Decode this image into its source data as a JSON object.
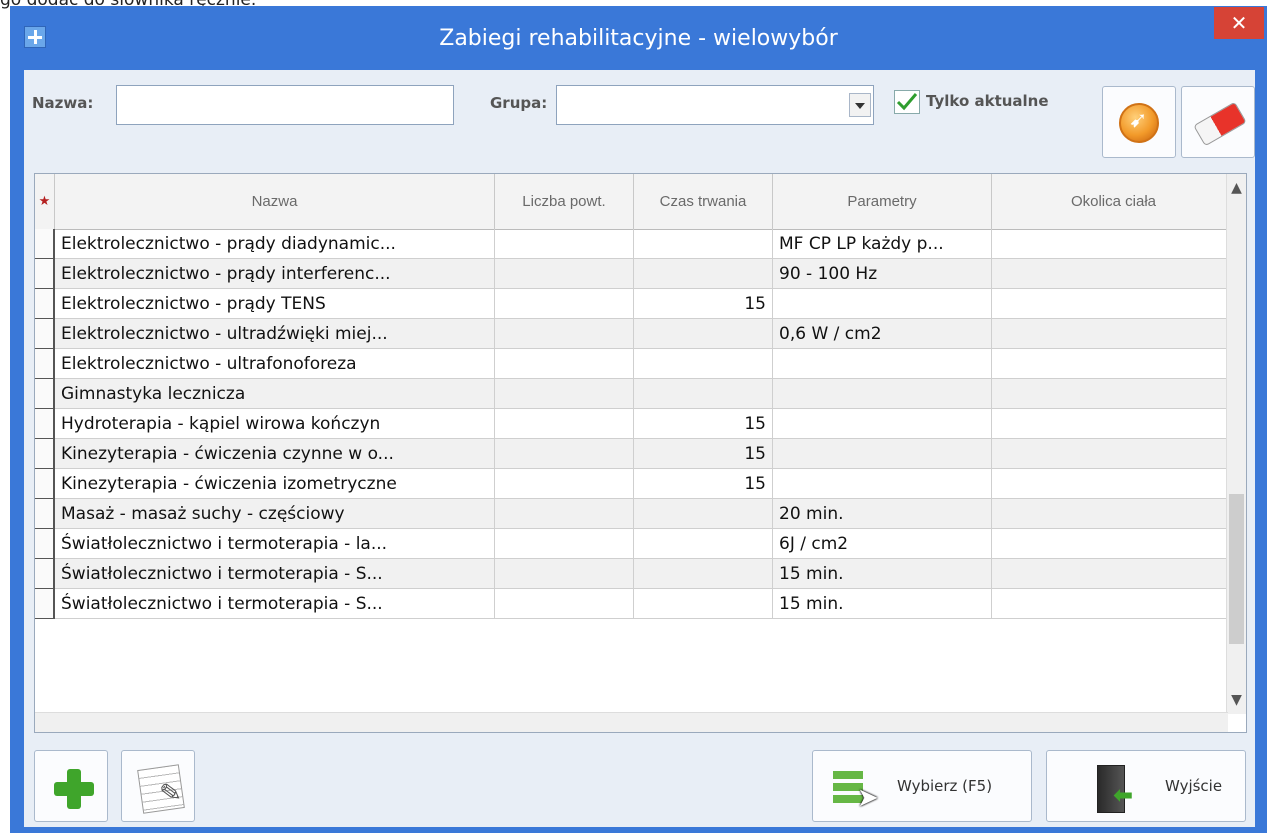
{
  "background_caption": "go dodać do słownika ręcznie.",
  "window": {
    "title": "Zabiegi rehabilitacyjne - wielowybór",
    "close_label": "✕"
  },
  "filters": {
    "name_label": "Nazwa:",
    "name_value": "",
    "group_label": "Grupa:",
    "group_value": "",
    "only_current_label": "Tylko aktualne",
    "only_current_checked": true
  },
  "grid": {
    "star": "★",
    "columns": [
      "Nazwa",
      "Liczba powt.",
      "Czas trwania",
      "Parametry",
      "Okolica ciała"
    ],
    "rows": [
      {
        "nazwa": "Elektrolecznictwo - prądy diadynamic...",
        "liczba": "",
        "czas": "",
        "parametry": "MF CP LP każdy p...",
        "okolica": ""
      },
      {
        "nazwa": "Elektrolecznictwo - prądy interferenc...",
        "liczba": "",
        "czas": "",
        "parametry": "90 - 100 Hz",
        "okolica": ""
      },
      {
        "nazwa": "Elektrolecznictwo - prądy TENS",
        "liczba": "",
        "czas": "15",
        "parametry": "",
        "okolica": ""
      },
      {
        "nazwa": "Elektrolecznictwo - ultradźwięki  miej...",
        "liczba": "",
        "czas": "",
        "parametry": "0,6 W / cm2",
        "okolica": ""
      },
      {
        "nazwa": "Elektrolecznictwo - ultrafonoforeza",
        "liczba": "",
        "czas": "",
        "parametry": "",
        "okolica": ""
      },
      {
        "nazwa": "Gimnastyka lecznicza",
        "liczba": "",
        "czas": "",
        "parametry": "",
        "okolica": ""
      },
      {
        "nazwa": "Hydroterapia - kąpiel wirowa kończyn",
        "liczba": "",
        "czas": "15",
        "parametry": "",
        "okolica": ""
      },
      {
        "nazwa": "Kinezyterapia - ćwiczenia czynne w o...",
        "liczba": "",
        "czas": "15",
        "parametry": "",
        "okolica": ""
      },
      {
        "nazwa": "Kinezyterapia - ćwiczenia izometryczne",
        "liczba": "",
        "czas": "15",
        "parametry": "",
        "okolica": ""
      },
      {
        "nazwa": "Masaż - masaż suchy - częściowy",
        "liczba": "",
        "czas": "",
        "parametry": "20 min.",
        "okolica": ""
      },
      {
        "nazwa": "Światłolecznictwo i termoterapia - la...",
        "liczba": "",
        "czas": "",
        "parametry": "6J / cm2",
        "okolica": ""
      },
      {
        "nazwa": "Światłolecznictwo i termoterapia - S...",
        "liczba": "",
        "czas": "",
        "parametry": "15 min.",
        "okolica": ""
      },
      {
        "nazwa": "Światłolecznictwo i termoterapia - S...",
        "liczba": "",
        "czas": "",
        "parametry": "15 min.",
        "okolica": ""
      }
    ]
  },
  "buttons": {
    "select_label": "Wybierz (F5)",
    "exit_label": "Wyjście"
  },
  "icons": {
    "app": "plus-window-icon",
    "refresh": "orange-refresh-icon",
    "clear": "eraser-icon",
    "add": "green-plus-icon",
    "edit": "document-edit-icon",
    "select": "select-list-icon",
    "exit": "exit-door-icon"
  },
  "colors": {
    "titlebar": "#3a78d8",
    "close": "#d64336",
    "client": "#e8eef6"
  }
}
